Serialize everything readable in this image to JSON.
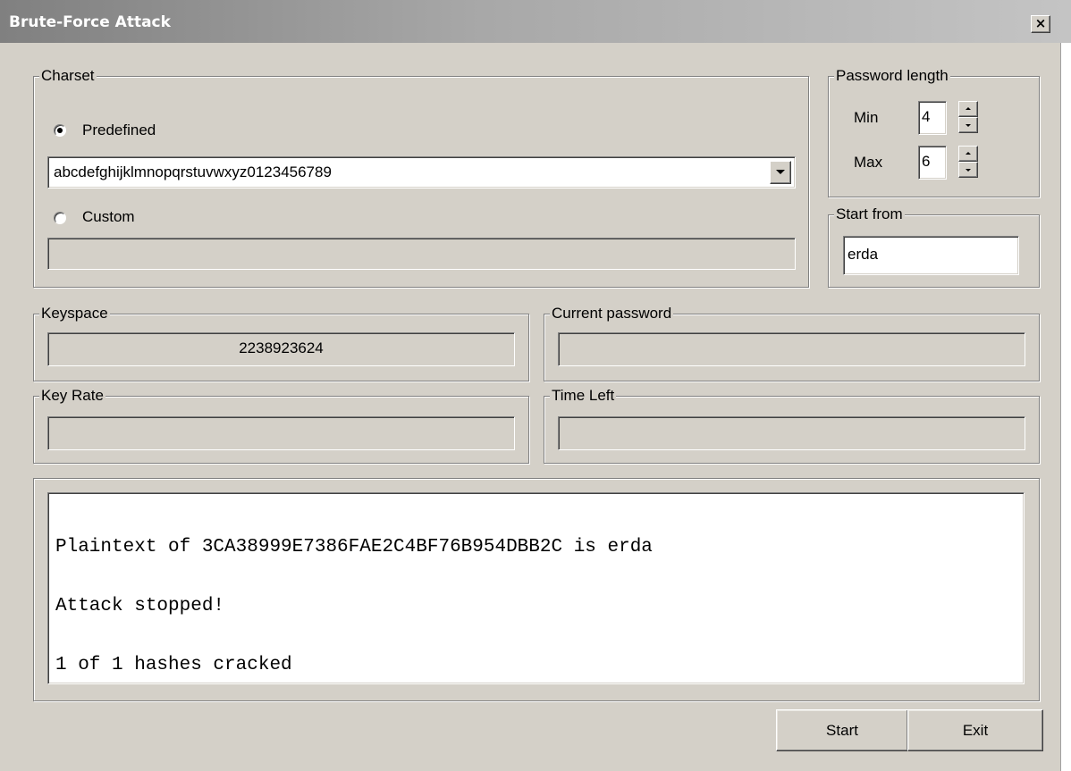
{
  "window": {
    "title": "Brute-Force Attack",
    "close_glyph": "×"
  },
  "charset": {
    "legend": "Charset",
    "predefined_label": "Predefined",
    "predefined_selected": true,
    "predefined_value": "abcdefghijklmnopqrstuvwxyz0123456789",
    "custom_label": "Custom",
    "custom_selected": false,
    "custom_value": ""
  },
  "password_length": {
    "legend": "Password length",
    "min_label": "Min",
    "min_value": "4",
    "max_label": "Max",
    "max_value": "6"
  },
  "start_from": {
    "legend": "Start from",
    "value": "erda"
  },
  "keyspace": {
    "legend": "Keyspace",
    "value": "2238923624"
  },
  "current_password": {
    "legend": "Current password",
    "value": ""
  },
  "key_rate": {
    "legend": "Key Rate",
    "value": ""
  },
  "time_left": {
    "legend": "Time Left",
    "value": ""
  },
  "log": {
    "lines": [
      "Plaintext of 3CA38999E7386FAE2C4BF76B954DBB2C is erda",
      "Attack stopped!",
      "1 of 1 hashes cracked"
    ]
  },
  "buttons": {
    "start": "Start",
    "exit": "Exit"
  },
  "icons": {
    "close": "close-icon",
    "dropdown": "chevron-down-icon",
    "spin_up": "spin-up-icon",
    "spin_down": "spin-down-icon"
  }
}
